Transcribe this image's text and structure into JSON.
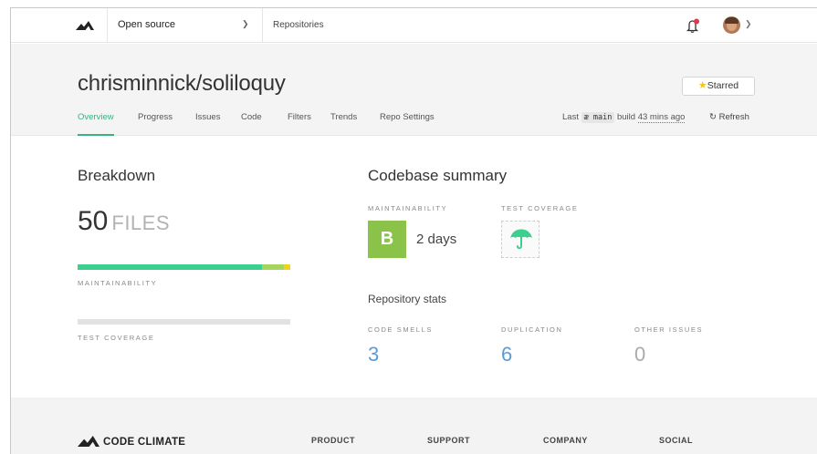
{
  "colors": {
    "accent": "#36b37e",
    "grade_b": "#8bc34a",
    "stat_blue": "#5b9bd5",
    "maint_green": "#3ccf8e",
    "maint_lime": "#a4d65e",
    "maint_yellow": "#f5d21a",
    "notification_dot": "#e8334a"
  },
  "topnav": {
    "logo_icon": "code-climate-logo-icon",
    "org_select": "Open source",
    "repositories_link": "Repositories",
    "notification_icon": "bell-icon",
    "avatar_icon": "user-avatar"
  },
  "header": {
    "repo_title": "chrisminnick/soliloquy",
    "starred_label": "Starred",
    "tabs": [
      {
        "label": "Overview",
        "active": true
      },
      {
        "label": "Progress"
      },
      {
        "label": "Issues"
      },
      {
        "label": "Code"
      },
      {
        "label": "Filters"
      },
      {
        "label": "Trends"
      },
      {
        "label": "Repo Settings"
      }
    ],
    "build": {
      "prefix": "Last",
      "branch": "main",
      "middle": "build",
      "ago": "43 mins ago"
    },
    "refresh_label": "Refresh"
  },
  "breakdown": {
    "title": "Breakdown",
    "file_count": "50",
    "file_label": "FILES",
    "maintainability_label": "MAINTAINABILITY",
    "maintainability_segments": [
      {
        "fraction": 0.865,
        "color": "#3ccf8e"
      },
      {
        "fraction": 0.105,
        "color": "#a4d65e"
      },
      {
        "fraction": 0.03,
        "color": "#f5d21a"
      }
    ],
    "test_coverage_label": "TEST COVERAGE"
  },
  "summary": {
    "title": "Codebase summary",
    "maintainability_label": "MAINTAINABILITY",
    "grade": "B",
    "days": "2 days",
    "test_coverage_label": "TEST COVERAGE",
    "coverage_icon": "umbrella-icon",
    "stats_title": "Repository stats",
    "stats": [
      {
        "label": "CODE SMELLS",
        "value": "3"
      },
      {
        "label": "DUPLICATION",
        "value": "6"
      },
      {
        "label": "OTHER ISSUES",
        "value": "0"
      }
    ]
  },
  "footer": {
    "logo_text": "CODE CLIMATE",
    "columns": [
      "PRODUCT",
      "SUPPORT",
      "COMPANY",
      "SOCIAL"
    ]
  }
}
